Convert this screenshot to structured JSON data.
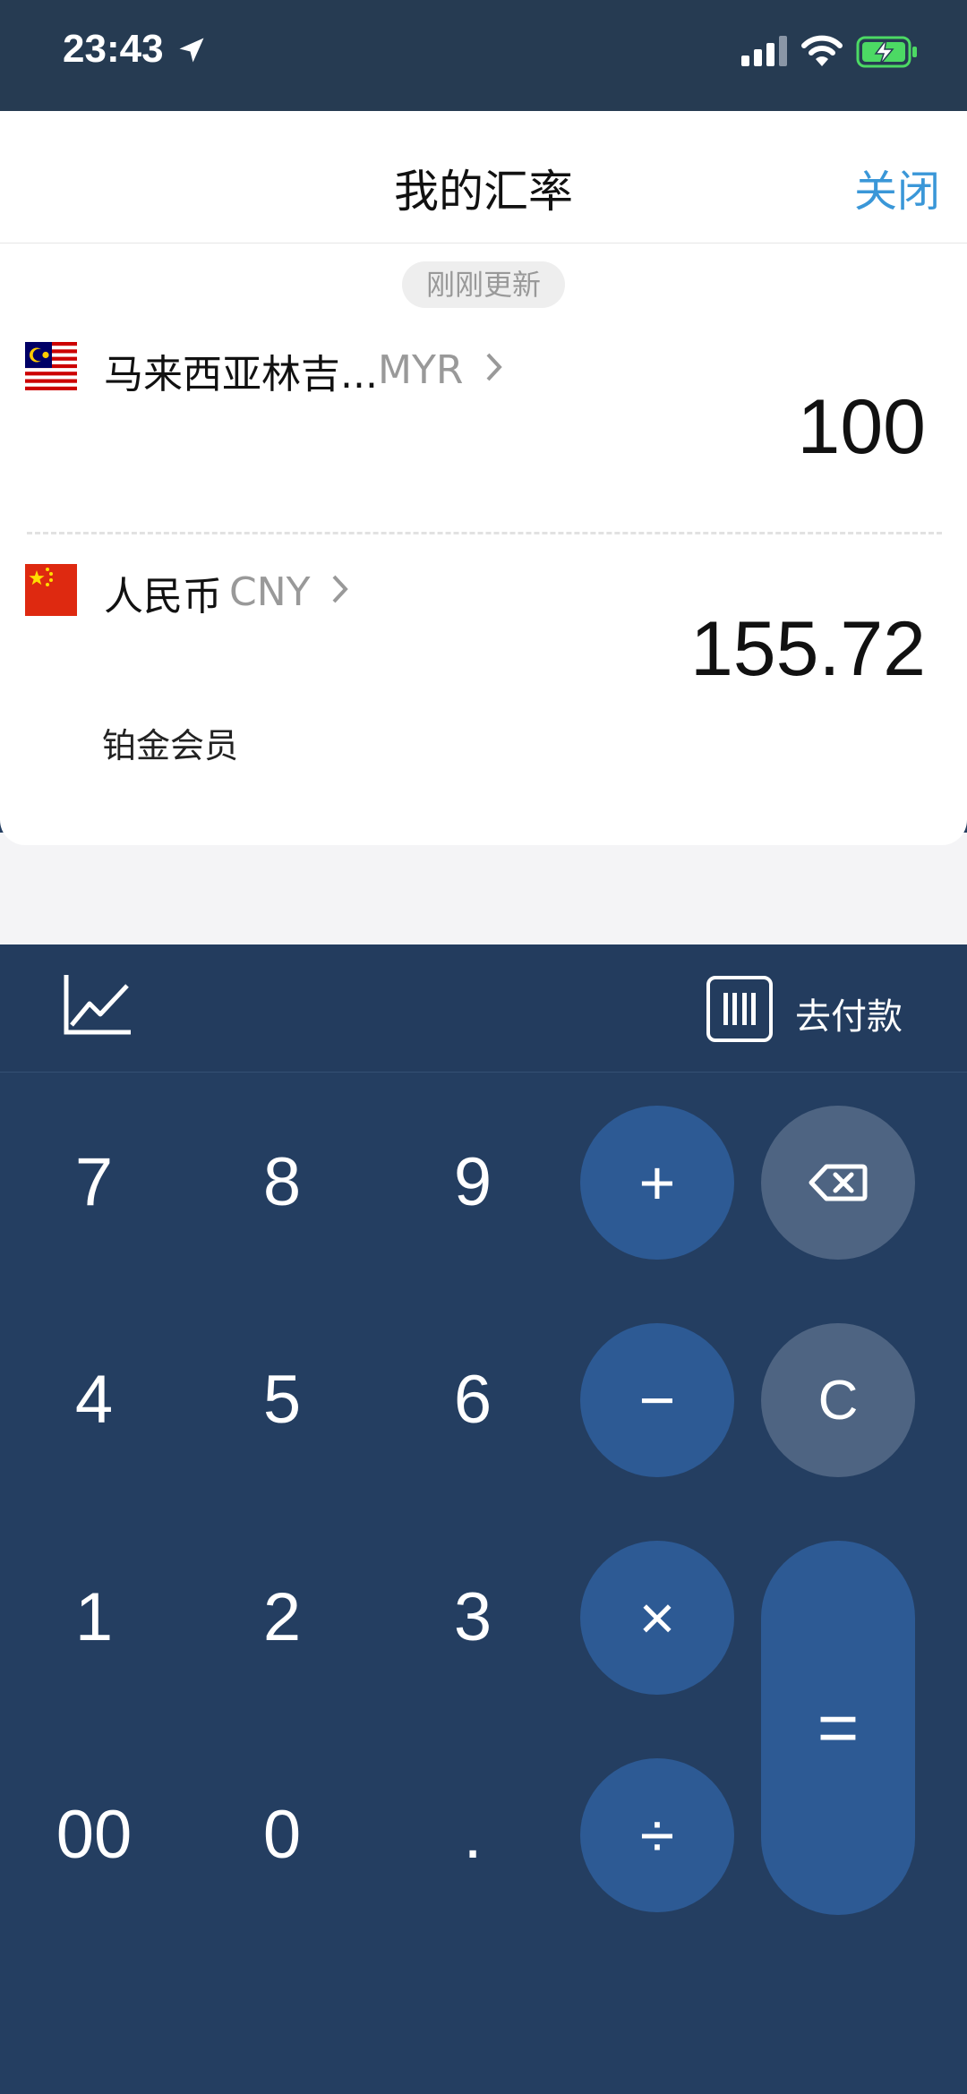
{
  "status_bar": {
    "time": "23:43",
    "icons": [
      "location-arrow-icon",
      "cellular-signal-icon",
      "wifi-icon",
      "battery-charging-icon"
    ]
  },
  "header": {
    "title": "我的汇率",
    "close_label": "关闭"
  },
  "card": {
    "update_text": "刚刚更新",
    "rows": [
      {
        "flag": "malaysia-flag-icon",
        "name": "马来西亚林吉...",
        "code": "MYR",
        "amount": "100"
      },
      {
        "flag": "china-flag-icon",
        "name": "人民币",
        "code": "CNY",
        "amount": "155.72"
      }
    ],
    "member_label": "铂金会员"
  },
  "toolbar": {
    "chart_icon": "trend-chart-icon",
    "pay_label": "去付款",
    "pay_icon": "barcode-icon"
  },
  "keypad": {
    "digits": [
      "7",
      "8",
      "9",
      "4",
      "5",
      "6",
      "1",
      "2",
      "3",
      "00",
      "0",
      "."
    ],
    "plus": "+",
    "minus": "−",
    "times": "×",
    "divide": "÷",
    "clear": "C",
    "equals": "=",
    "backspace_icon": "backspace-icon"
  },
  "colors": {
    "status_bar": "#263b52",
    "keypad_bg": "#243e61",
    "operator_key": "#2d5a94",
    "grey_key": "#4e6482",
    "accent_link": "#3a97d8",
    "battery_green": "#4cd964"
  }
}
